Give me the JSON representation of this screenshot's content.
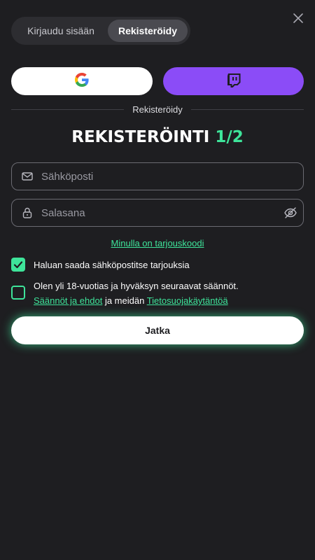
{
  "tabs": {
    "login_label": "Kirjaudu sisään",
    "register_label": "Rekisteröidy",
    "active": "register"
  },
  "social": {
    "google_icon": "google-icon",
    "twitch_icon": "twitch-icon"
  },
  "divider_label": "Rekisteröidy",
  "title": {
    "text": "REKISTERÖINTI",
    "step": "1/2"
  },
  "email": {
    "placeholder": "Sähköposti",
    "value": ""
  },
  "password": {
    "placeholder": "Salasana",
    "value": ""
  },
  "promo_link": "Minulla on tarjouskoodi",
  "marketing_checkbox": {
    "checked": true,
    "label": "Haluan saada sähköpostitse tarjouksia"
  },
  "terms_checkbox": {
    "checked": false,
    "text_start": "Olen yli 18-vuotias ja hyväksyn seuraavat säännöt.",
    "terms_link": "Säännöt ja ehdot",
    "middle": "ja meidän",
    "privacy_link": "Tietosuojakäytäntöä"
  },
  "continue_button": "Jatka",
  "colors": {
    "accent": "#3ee49a",
    "twitch": "#8b4cf7",
    "background": "#1e1e21"
  }
}
